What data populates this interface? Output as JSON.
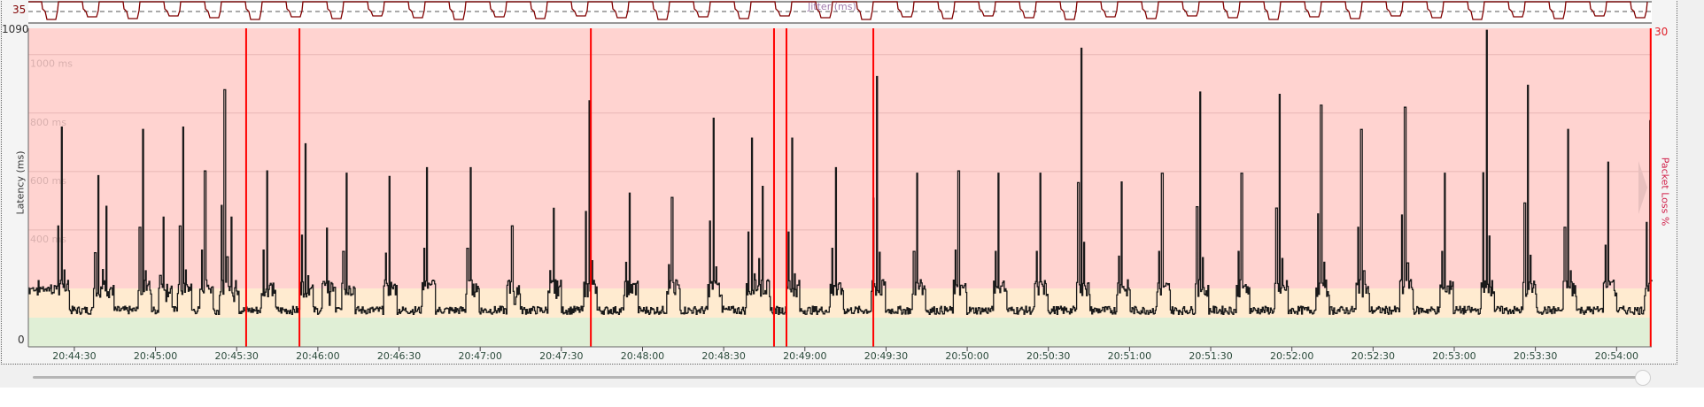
{
  "colors": {
    "bad": "#ffd3d0",
    "warn": "#ffebd0",
    "good": "#e0efd6",
    "latency_line": "#1a1a1a",
    "loss_line": "#ff0000",
    "jitter_line": "#800000"
  },
  "jitter": {
    "title": "Jitter (ms)",
    "ref_label": "35",
    "ref_value": 35
  },
  "chart_data": {
    "type": "line",
    "title": "",
    "ylabel": "Latency (ms)",
    "y2label": "Packet Loss %",
    "ymax_label": "1090",
    "ymin_label": "0",
    "y2max_label": "30",
    "ylim": [
      0,
      1090
    ],
    "y2lim": [
      0,
      30
    ],
    "x_unit": "seconds after 20:44:00",
    "xlim": [
      13,
      613
    ],
    "gridlines": [
      {
        "value": 1000,
        "label": "1000 ms"
      },
      {
        "value": 800,
        "label": "800 ms"
      },
      {
        "value": 600,
        "label": "600 ms"
      },
      {
        "value": 400,
        "label": "400 ms"
      }
    ],
    "zones": [
      {
        "name": "good",
        "from": 0,
        "to": 100
      },
      {
        "name": "warn",
        "from": 100,
        "to": 200
      },
      {
        "name": "bad",
        "from": 200,
        "to": 1090
      }
    ],
    "xticks": [
      {
        "t": 30,
        "label": "20:44:30"
      },
      {
        "t": 60,
        "label": "20:45:00"
      },
      {
        "t": 90,
        "label": "20:45:30"
      },
      {
        "t": 120,
        "label": "20:46:00"
      },
      {
        "t": 150,
        "label": "20:46:30"
      },
      {
        "t": 180,
        "label": "20:47:00"
      },
      {
        "t": 210,
        "label": "20:47:30"
      },
      {
        "t": 240,
        "label": "20:48:00"
      },
      {
        "t": 270,
        "label": "20:48:30"
      },
      {
        "t": 300,
        "label": "20:49:00"
      },
      {
        "t": 330,
        "label": "20:49:30"
      },
      {
        "t": 360,
        "label": "20:50:00"
      },
      {
        "t": 390,
        "label": "20:50:30"
      },
      {
        "t": 420,
        "label": "20:51:00"
      },
      {
        "t": 450,
        "label": "20:51:30"
      },
      {
        "t": 480,
        "label": "20:52:00"
      },
      {
        "t": 510,
        "label": "20:52:30"
      },
      {
        "t": 540,
        "label": "20:53:00"
      },
      {
        "t": 570,
        "label": "20:53:30"
      },
      {
        "t": 600,
        "label": "20:54:00"
      }
    ],
    "baseline_ms": 125,
    "baseline_noise_ms": 14,
    "latency_spikes": [
      [
        25.1,
        752
      ],
      [
        38.8,
        586
      ],
      [
        41.6,
        481
      ],
      [
        55.3,
        744
      ],
      [
        62.9,
        444
      ],
      [
        70.1,
        752
      ],
      [
        78.2,
        602
      ],
      [
        85.4,
        880
      ],
      [
        87.8,
        444
      ],
      [
        101.1,
        602
      ],
      [
        115.2,
        695
      ],
      [
        123.3,
        406
      ],
      [
        130.5,
        594
      ],
      [
        146.2,
        583
      ],
      [
        160.3,
        613
      ],
      [
        176.4,
        613
      ],
      [
        191.7,
        414
      ],
      [
        207,
        474
      ],
      [
        220.2,
        842
      ],
      [
        235.1,
        526
      ],
      [
        250.8,
        511
      ],
      [
        266.1,
        782
      ],
      [
        280.2,
        714
      ],
      [
        284.2,
        549
      ],
      [
        295.1,
        714
      ],
      [
        311.2,
        613
      ],
      [
        326.5,
        925
      ],
      [
        341.4,
        594
      ],
      [
        356.7,
        602
      ],
      [
        371.5,
        594
      ],
      [
        386.8,
        594
      ],
      [
        402.1,
        1022
      ],
      [
        417,
        564
      ],
      [
        431.9,
        594
      ],
      [
        446,
        872
      ],
      [
        461.3,
        594
      ],
      [
        475.4,
        864
      ],
      [
        490.7,
        827
      ],
      [
        505.5,
        744
      ],
      [
        521.7,
        820
      ],
      [
        536.5,
        594
      ],
      [
        551.8,
        1083
      ],
      [
        567.1,
        895
      ],
      [
        582,
        744
      ],
      [
        596.9,
        632
      ],
      [
        612.2,
        774
      ]
    ],
    "packet_loss_events": [
      93.5,
      113.2,
      220.9,
      288.6,
      293.2,
      325.3,
      612.6
    ]
  }
}
